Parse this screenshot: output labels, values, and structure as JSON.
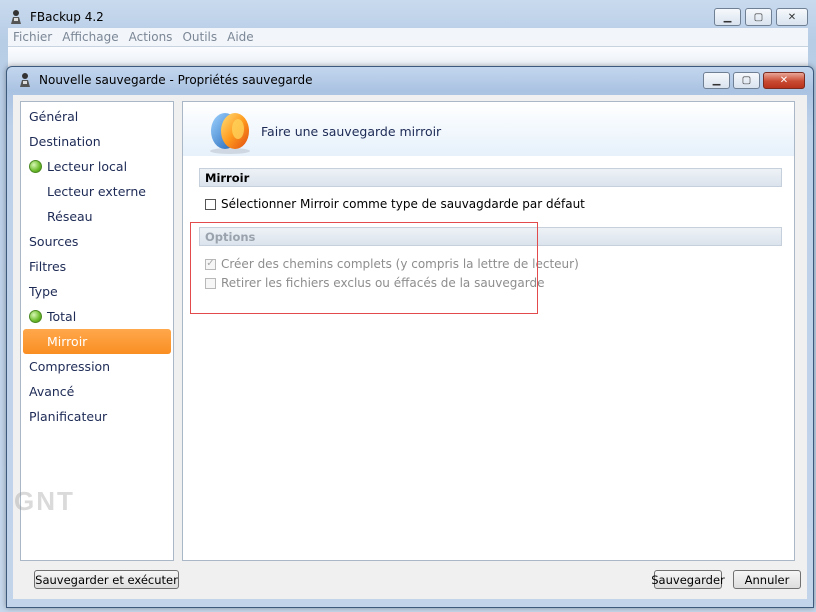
{
  "main_window": {
    "title": "FBackup  4.2",
    "menu": [
      "Fichier",
      "Affichage",
      "Actions",
      "Outils",
      "Aide"
    ]
  },
  "dialog": {
    "title": "Nouvelle sauvegarde - Propriétés sauvegarde",
    "nav": {
      "items": [
        {
          "label": "Général",
          "indent": false,
          "dot": false,
          "selected": false
        },
        {
          "label": "Destination",
          "indent": false,
          "dot": false,
          "selected": false
        },
        {
          "label": "Lecteur local",
          "indent": true,
          "dot": true,
          "selected": false
        },
        {
          "label": "Lecteur externe",
          "indent": true,
          "dot": false,
          "selected": false
        },
        {
          "label": "Réseau",
          "indent": true,
          "dot": false,
          "selected": false
        },
        {
          "label": "Sources",
          "indent": false,
          "dot": false,
          "selected": false
        },
        {
          "label": "Filtres",
          "indent": false,
          "dot": false,
          "selected": false
        },
        {
          "label": "Type",
          "indent": false,
          "dot": false,
          "selected": false
        },
        {
          "label": "Total",
          "indent": true,
          "dot": true,
          "selected": false
        },
        {
          "label": "Mirroir",
          "indent": true,
          "dot": false,
          "selected": true
        },
        {
          "label": "Compression",
          "indent": false,
          "dot": false,
          "selected": false
        },
        {
          "label": "Avancé",
          "indent": false,
          "dot": false,
          "selected": false
        },
        {
          "label": "Planificateur",
          "indent": false,
          "dot": false,
          "selected": false
        }
      ]
    },
    "panel": {
      "heading": "Faire une sauvegarde mirroir",
      "mirror_section": "Mirroir",
      "default_checkbox": {
        "label": "Sélectionner Mirroir comme type de sauvagdarde par défaut",
        "checked": false
      },
      "options_section": "Options",
      "options": [
        {
          "label": "Créer des chemins complets (y compris la lettre de lecteur)",
          "checked": true,
          "enabled": false
        },
        {
          "label": "Retirer les fichiers exclus ou éffacés de la sauvegarde",
          "checked": false,
          "enabled": false
        }
      ]
    },
    "buttons": {
      "save_and_run": "Sauvegarder et exécuter",
      "save": "Sauvegarder",
      "cancel": "Annuler"
    }
  },
  "watermark": "GNT",
  "colors": {
    "selected_nav": "#f98e22",
    "highlight": "#e24b4b"
  }
}
